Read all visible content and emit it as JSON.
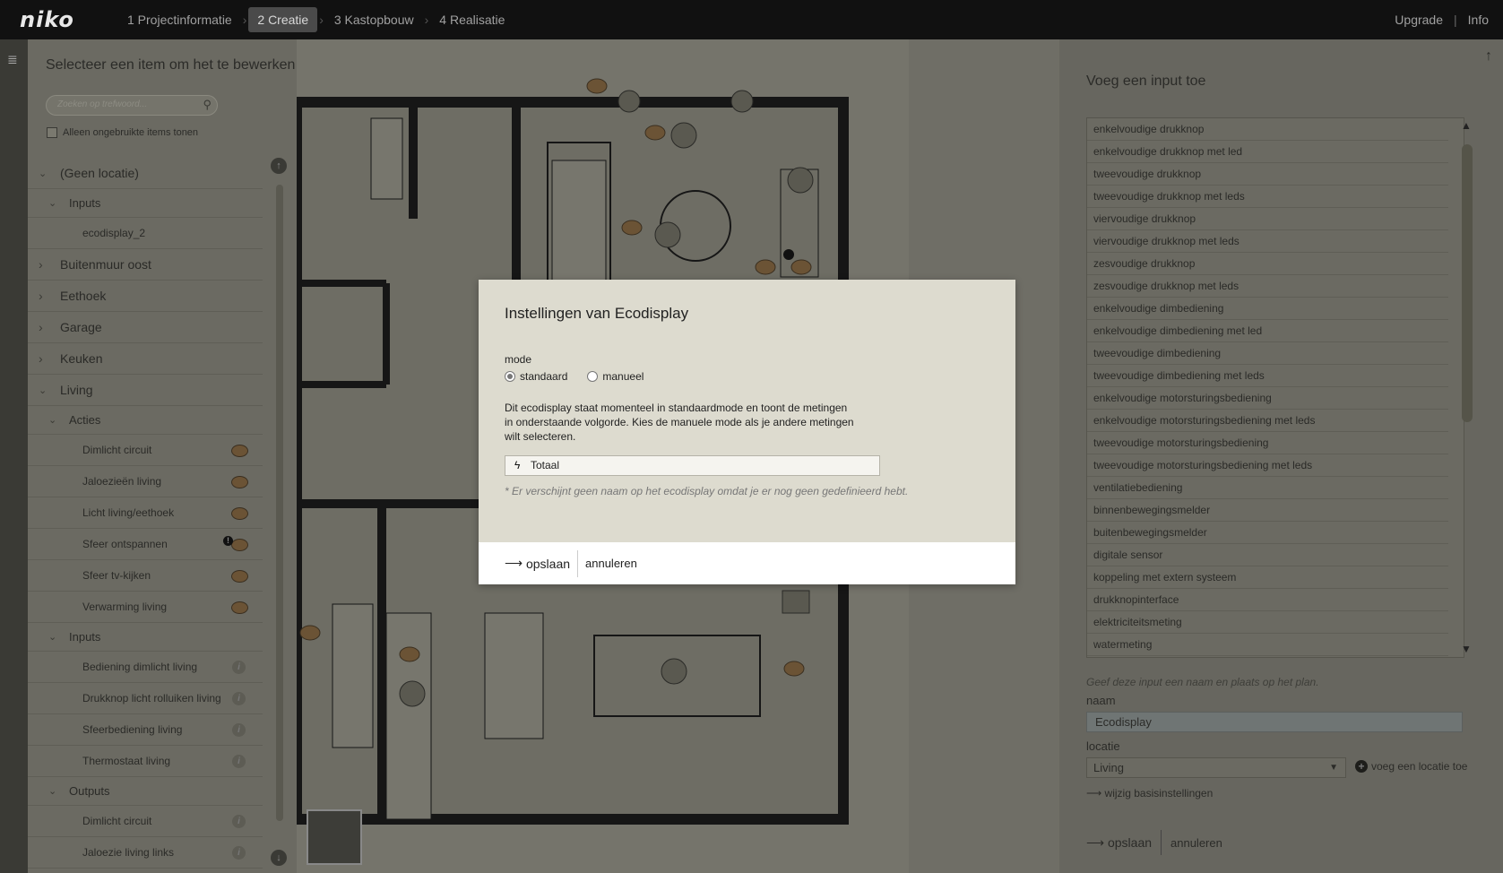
{
  "app": {
    "logo": "niko"
  },
  "steps": [
    {
      "label": "1 Projectinformatie",
      "active": false
    },
    {
      "label": "2 Creatie",
      "active": true
    },
    {
      "label": "3 Kastopbouw",
      "active": false
    },
    {
      "label": "4 Realisatie",
      "active": false
    }
  ],
  "topright": {
    "upgrade": "Upgrade",
    "separator": "|",
    "info": "Info"
  },
  "left": {
    "title": "Selecteer een item om het te bewerken",
    "search_placeholder": "Zoeken op trefwoord...",
    "filter_label": "Alleen ongebruikte items tonen",
    "tree": [
      {
        "level": 0,
        "label": "(Geen locatie)",
        "expanded": true
      },
      {
        "level": 1,
        "label": "Inputs",
        "expanded": true
      },
      {
        "level": 2,
        "label": "ecodisplay_2",
        "marker": "none"
      },
      {
        "level": 0,
        "label": "Buitenmuur oost",
        "expanded": false
      },
      {
        "level": 0,
        "label": "Eethoek",
        "expanded": false
      },
      {
        "level": 0,
        "label": "Garage",
        "expanded": false
      },
      {
        "level": 0,
        "label": "Keuken",
        "expanded": false
      },
      {
        "level": 0,
        "label": "Living",
        "expanded": true
      },
      {
        "level": 1,
        "label": "Acties",
        "expanded": true
      },
      {
        "level": 2,
        "label": "Dimlicht circuit",
        "marker": "bubble"
      },
      {
        "level": 2,
        "label": "Jaloezieën living",
        "marker": "bubble"
      },
      {
        "level": 2,
        "label": "Licht living/eethoek",
        "marker": "bubble"
      },
      {
        "level": 2,
        "label": "Sfeer ontspannen",
        "marker": "bubble-warn"
      },
      {
        "level": 2,
        "label": "Sfeer tv-kijken",
        "marker": "bubble"
      },
      {
        "level": 2,
        "label": "Verwarming living",
        "marker": "bubble"
      },
      {
        "level": 1,
        "label": "Inputs",
        "expanded": true
      },
      {
        "level": 2,
        "label": "Bediening dimlicht living",
        "marker": "info"
      },
      {
        "level": 2,
        "label": "Drukknop licht rolluiken living",
        "marker": "info"
      },
      {
        "level": 2,
        "label": "Sfeerbediening living",
        "marker": "info"
      },
      {
        "level": 2,
        "label": "Thermostaat living",
        "marker": "info"
      },
      {
        "level": 1,
        "label": "Outputs",
        "expanded": true
      },
      {
        "level": 2,
        "label": "Dimlicht circuit",
        "marker": "info"
      },
      {
        "level": 2,
        "label": "Jaloezie living links",
        "marker": "info"
      }
    ]
  },
  "right": {
    "title": "Voeg een input toe",
    "items": [
      "enkelvoudige drukknop",
      "enkelvoudige drukknop met led",
      "tweevoudige drukknop",
      "tweevoudige drukknop met leds",
      "viervoudige drukknop",
      "viervoudige drukknop met leds",
      "zesvoudige drukknop",
      "zesvoudige drukknop met leds",
      "enkelvoudige dimbediening",
      "enkelvoudige dimbediening met led",
      "tweevoudige dimbediening",
      "tweevoudige dimbediening met leds",
      "enkelvoudige motorsturingsbediening",
      "enkelvoudige motorsturingsbediening met leds",
      "tweevoudige motorsturingsbediening",
      "tweevoudige motorsturingsbediening met leds",
      "ventilatiebediening",
      "binnenbewegingsmelder",
      "buitenbewegingsmelder",
      "digitale sensor",
      "koppeling met extern systeem",
      "drukknopinterface",
      "elektriciteitsmeting",
      "watermeting"
    ],
    "hint": "Geef deze input een naam en plaats op het plan.",
    "name_label": "naam",
    "name_value": "Ecodisplay",
    "location_label": "locatie",
    "location_value": "Living",
    "add_location": "voeg een locatie toe",
    "basic_settings": "wijzig basisinstellingen",
    "save": "opslaan",
    "cancel": "annuleren"
  },
  "modal": {
    "title": "Instellingen van Ecodisplay",
    "mode_label": "mode",
    "options": [
      {
        "label": "standaard",
        "selected": true
      },
      {
        "label": "manueel",
        "selected": false
      }
    ],
    "description": "Dit ecodisplay staat momenteel in standaardmode en toont de metingen in onderstaande volgorde. Kies de manuele mode als je andere metingen wilt selecteren.",
    "field_value": "Totaal",
    "note": "* Er verschijnt geen naam op het ecodisplay omdat je er nog geen gedefinieerd hebt.",
    "save": "opslaan",
    "cancel": "annuleren"
  }
}
